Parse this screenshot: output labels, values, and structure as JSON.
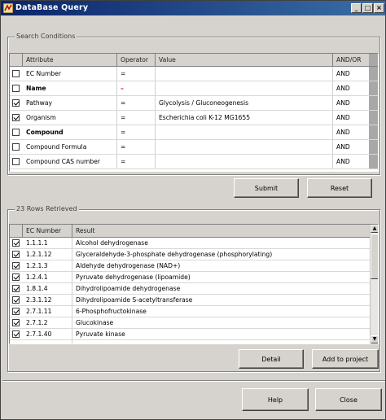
{
  "window": {
    "title": "DataBase Query"
  },
  "search": {
    "group_title": "Search Conditions",
    "headers": {
      "attribute": "Attribute",
      "operator": "Operator",
      "value": "Value",
      "andor": "AND/OR"
    },
    "rows": [
      {
        "checked": false,
        "attribute": "EC Number",
        "operator": "=",
        "operator_red": false,
        "value": "",
        "andor": "AND",
        "bold": false
      },
      {
        "checked": false,
        "attribute": "Name",
        "operator": "–",
        "operator_red": true,
        "value": "",
        "andor": "AND",
        "bold": true
      },
      {
        "checked": true,
        "attribute": "Pathway",
        "operator": "=",
        "operator_red": false,
        "value": "Glycolysis / Gluconeogenesis",
        "andor": "AND",
        "bold": false
      },
      {
        "checked": true,
        "attribute": "Organism",
        "operator": "=",
        "operator_red": false,
        "value": "Escherichia coli K-12 MG1655",
        "andor": "AND",
        "bold": false
      },
      {
        "checked": false,
        "attribute": "Compound",
        "operator": "=",
        "operator_red": false,
        "value": "",
        "andor": "AND",
        "bold": true
      },
      {
        "checked": false,
        "attribute": "Compound Formula",
        "operator": "=",
        "operator_red": false,
        "value": "",
        "andor": "AND",
        "bold": false
      },
      {
        "checked": false,
        "attribute": "Compound CAS number",
        "operator": "=",
        "operator_red": false,
        "value": "",
        "andor": "AND",
        "bold": false
      }
    ],
    "submit_label": "Submit",
    "reset_label": "Reset"
  },
  "results": {
    "group_title": "23 Rows Retrieved",
    "headers": {
      "ec": "EC Number",
      "result": "Result"
    },
    "rows": [
      {
        "checked": true,
        "ec": "1.1.1.1",
        "result": "Alcohol dehydrogenase"
      },
      {
        "checked": true,
        "ec": "1.2.1.12",
        "result": "Glyceraldehyde-3-phosphate dehydrogenase (phosphorylating)"
      },
      {
        "checked": true,
        "ec": "1.2.1.3",
        "result": "Aldehyde dehydrogenase (NAD+)"
      },
      {
        "checked": true,
        "ec": "1.2.4.1",
        "result": "Pyruvate dehydrogenase (lipoamide)"
      },
      {
        "checked": true,
        "ec": "1.8.1.4",
        "result": "Dihydrolipoamide dehydrogenase"
      },
      {
        "checked": true,
        "ec": "2.3.1.12",
        "result": "Dihydrolipoamide S-acetyltransferase"
      },
      {
        "checked": true,
        "ec": "2.7.1.11",
        "result": "6-Phosphofructokinase"
      },
      {
        "checked": true,
        "ec": "2.7.1.2",
        "result": "Glucokinase"
      },
      {
        "checked": true,
        "ec": "2.7.1.40",
        "result": "Pyruvate kinase"
      }
    ],
    "detail_label": "Detail",
    "add_label": "Add to project"
  },
  "footer": {
    "help_label": "Help",
    "close_label": "Close"
  }
}
